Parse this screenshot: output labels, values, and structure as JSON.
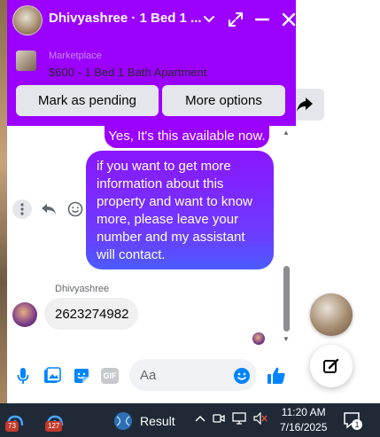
{
  "header": {
    "title": "Dhivyashree · 1 Bed 1 ...",
    "marketplace_label": "Marketplace",
    "listing_title": "$600 - 1 Bed 1 Bath Apartment",
    "mark_pending_label": "Mark as pending",
    "more_options_label": "More options"
  },
  "messages": {
    "outgoing_short": "Yes, It's this available now.",
    "outgoing_long": "if you want to get more information about this property and want to know more, please leave your number and my assistant will contact.",
    "sender_name": "Dhivyashree",
    "incoming": "2623274982"
  },
  "composer": {
    "placeholder": "Aa",
    "gif_label": "GIF"
  },
  "taskbar": {
    "app1_badge": "73",
    "app2_badge": "127",
    "result_label": "Result",
    "time": "11:20 AM",
    "date": "7/16/2025",
    "notification_count": "1"
  },
  "colors": {
    "header_purple": "#9b00ff",
    "message_gradient_top": "#8a16ff",
    "message_gradient_bottom": "#4b5cff",
    "accent_blue": "#0084ff",
    "taskbar_bg": "#1f2a36"
  },
  "icons": [
    "chevron-down-icon",
    "expand-icon",
    "minimize-icon",
    "close-icon",
    "share-icon",
    "more-vertical-icon",
    "reply-icon",
    "emoji-icon",
    "microphone-icon",
    "image-icon",
    "sticker-icon",
    "gif-icon",
    "like-icon",
    "compose-icon",
    "chevron-up-icon",
    "video-icon",
    "monitor-icon",
    "mute-icon",
    "notification-icon"
  ]
}
